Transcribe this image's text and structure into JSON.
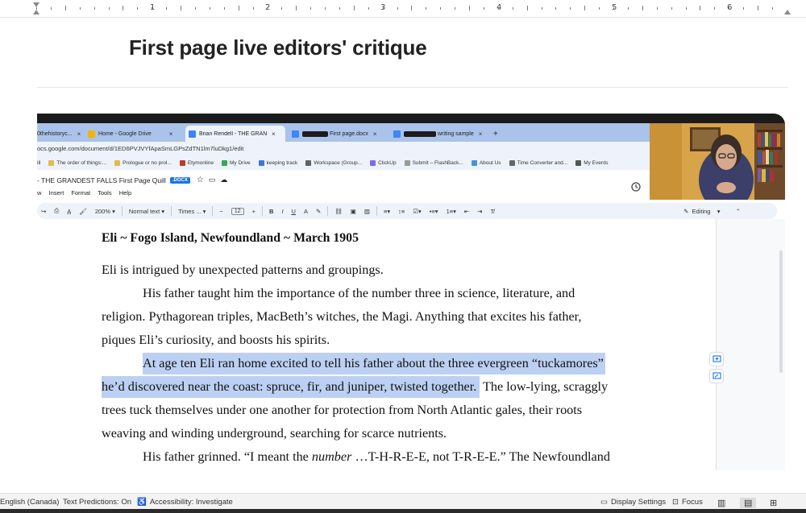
{
  "word": {
    "title": "First page live editors' critique",
    "ruler_numbers": [
      "1",
      "2",
      "3",
      "4",
      "5",
      "6"
    ]
  },
  "browser": {
    "tabs": [
      {
        "label": "0thehistoryc...",
        "fav_color": "#6d8fc9"
      },
      {
        "label": "Home - Google Drive",
        "fav_color": "#f4b400"
      },
      {
        "label": "Brian Rendell - THE GRANDEST",
        "fav_color": "#4285f4"
      },
      {
        "label": "First page.docx",
        "fav_color": "#4285f4"
      },
      {
        "label": "writing sample",
        "fav_color": "#4285f4"
      }
    ],
    "new_tab": "+",
    "url": "ocs.google.com/document/d/1ED6PVJVYfApaSmLGPsZdTN1lm7luDkg1/edit",
    "bookmarks": [
      "ill",
      "The order of things:...",
      "Prologue or no prol...",
      "Etymonline",
      "My Drive",
      "keeping track",
      "Workspace (Group...",
      "ClickUp",
      "Submit – FlashBack...",
      "About Us",
      "Time Converter and...",
      "My Events"
    ]
  },
  "gdoc": {
    "title": "- THE GRANDEST FALLS First Page Quill",
    "badge": ".DOCX",
    "menu": [
      "w",
      "Insert",
      "Format",
      "Tools",
      "Help"
    ],
    "zoom": "200%",
    "style": "Normal text",
    "font": "Times ...",
    "font_size": "12",
    "mode": "Editing"
  },
  "manuscript": {
    "heading": "Eli ~ Fogo Island, Newfoundland ~ March 1905",
    "l1": "Eli is intrigued by unexpected patterns and groupings.",
    "l2": "His father taught him the importance of the number three in science, literature, and",
    "l3": "religion. Pythagorean triples, MacBeth’s witches, the Magi. Anything that excites his father,",
    "l4": "piques Eli’s curiosity, and boosts his spirits.",
    "l5": "At age ten Eli ran home excited to tell his father about the three evergreen “tuckamores”",
    "l6a": "he’d discovered near the coast: spruce, fir, and juniper, twisted together.",
    "l6b": " The low-lying, scraggly",
    "l7": "trees tuck themselves under one another for protection from North Atlantic gales, their roots",
    "l8": "weaving and winding underground, searching for scarce nutrients.",
    "l9a": "His father grinned. “I meant the ",
    "l9b": "number",
    "l9c": " …T-H-R-E-E, not T-R-E-E.” The Newfoundland"
  },
  "status": {
    "language": "English (Canada)",
    "predictions": "Text Predictions: On",
    "accessibility": "Accessibility: Investigate",
    "display": "Display Settings",
    "focus": "Focus"
  }
}
